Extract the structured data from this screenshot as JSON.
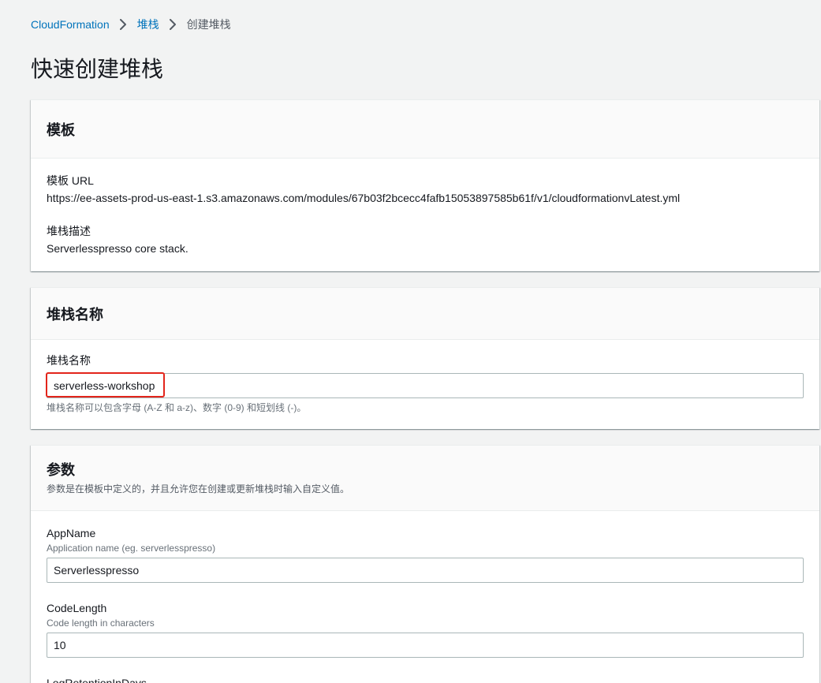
{
  "breadcrumb": {
    "items": [
      "CloudFormation",
      "堆栈",
      "创建堆栈"
    ]
  },
  "page": {
    "title": "快速创建堆栈"
  },
  "template_panel": {
    "title": "模板",
    "url_label": "模板 URL",
    "url_value": "https://ee-assets-prod-us-east-1.s3.amazonaws.com/modules/67b03f2bcecc4fafb15053897585b61f/v1/cloudformationvLatest.yml",
    "desc_label": "堆栈描述",
    "desc_value": "Serverlesspresso core stack."
  },
  "stack_name_panel": {
    "title": "堆栈名称",
    "field_label": "堆栈名称",
    "field_value": "serverless-workshop",
    "hint": "堆栈名称可以包含字母 (A-Z 和 a-z)、数字 (0-9) 和短划线 (-)。"
  },
  "parameters_panel": {
    "title": "参数",
    "description": "参数是在模板中定义的，并且允许您在创建或更新堆栈时输入自定义值。",
    "params": [
      {
        "name": "AppName",
        "description": "Application name (eg. serverlesspresso)",
        "value": "Serverlesspresso"
      },
      {
        "name": "CodeLength",
        "description": "Code length in characters",
        "value": "10"
      },
      {
        "name": "LogRetentionInDays"
      }
    ]
  },
  "colors": {
    "link": "#0073bb",
    "highlight": "#e3251b",
    "background": "#f2f3f3",
    "panel_header": "#fafafa"
  },
  "icons": {
    "breadcrumb_separator": "chevron-right-icon"
  }
}
